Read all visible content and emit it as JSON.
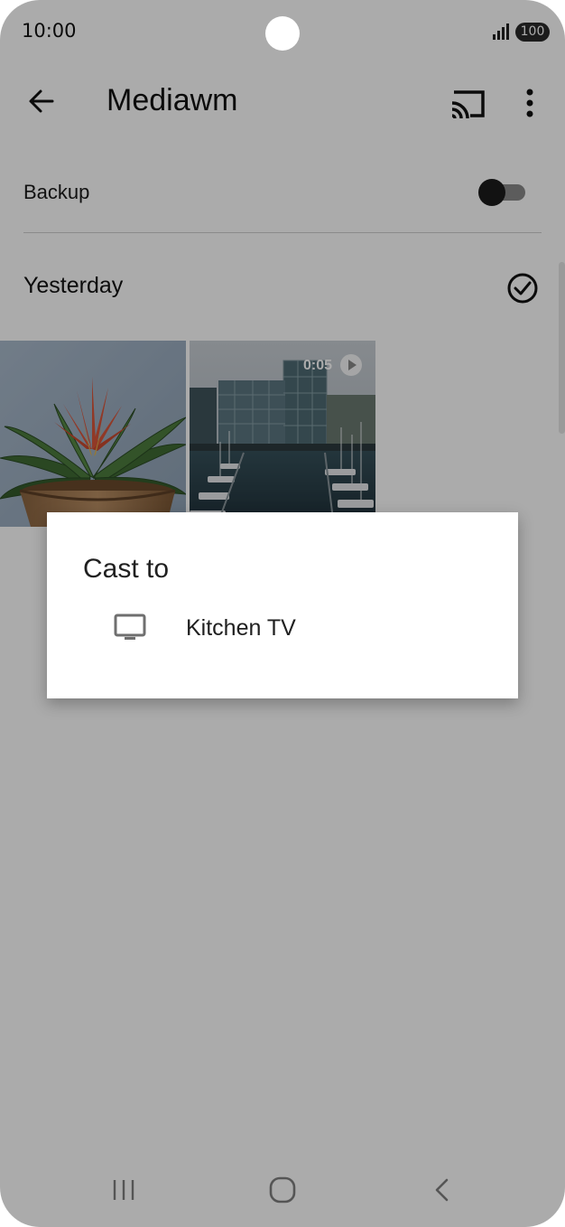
{
  "status_bar": {
    "time": "10:00",
    "battery": "100"
  },
  "app_bar": {
    "title": "Mediawm",
    "icons": [
      "back-arrow-icon",
      "cast-icon",
      "more-vert-icon"
    ]
  },
  "backup": {
    "label": "Backup",
    "toggle_on": false
  },
  "section": {
    "title": "Yesterday"
  },
  "photos": [
    {
      "type": "image",
      "subject": "potted bromeliad plant"
    },
    {
      "type": "video",
      "duration": "0:05",
      "subject": "harbor with office buildings and boats"
    }
  ],
  "dialog": {
    "title": "Cast to",
    "devices": [
      {
        "label": "Kitchen TV",
        "icon": "tv-icon"
      }
    ]
  },
  "colors": {
    "scrim": "#000000",
    "dialog_bg": "#ffffff",
    "text": "#202020"
  }
}
